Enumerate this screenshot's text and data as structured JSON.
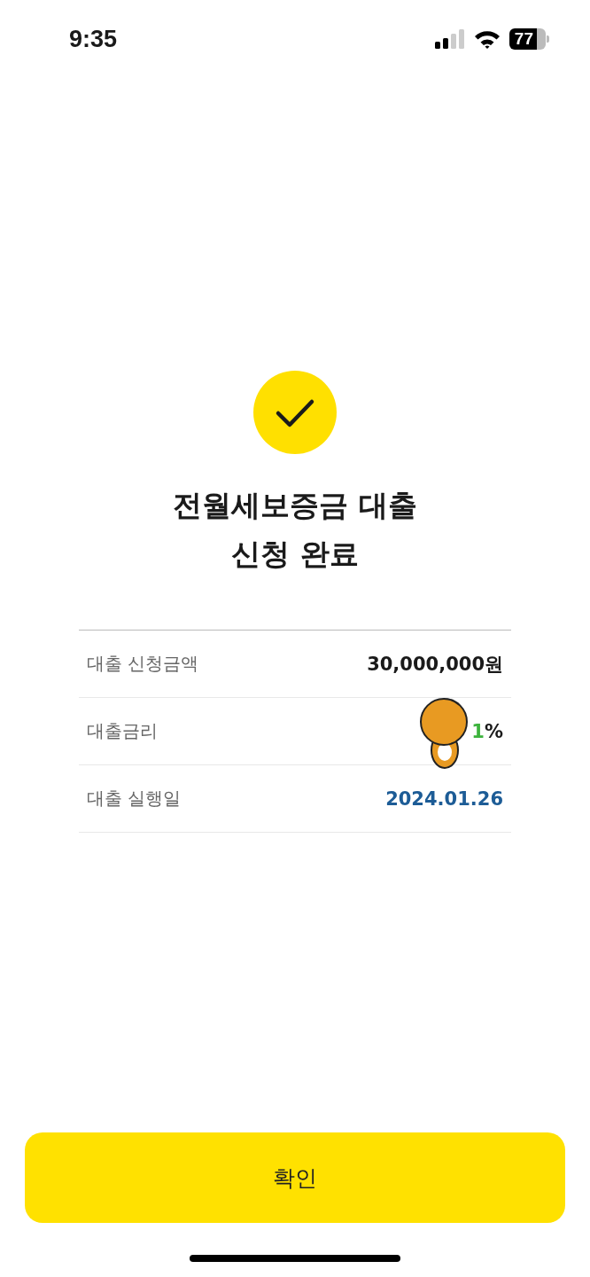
{
  "status_bar": {
    "time": "9:35",
    "battery": "77"
  },
  "title_lines": [
    "전월세보증금 대출",
    "신청 완료"
  ],
  "rows": [
    {
      "kind": "plain",
      "label": "대출 신청금액",
      "value": "30,000,000원"
    },
    {
      "kind": "rate",
      "label": "대출금리",
      "value_green": "1",
      "value_unit": "%"
    },
    {
      "kind": "date",
      "label": "대출 실행일",
      "value": "2024.01.26"
    }
  ],
  "confirm_button": "확인"
}
